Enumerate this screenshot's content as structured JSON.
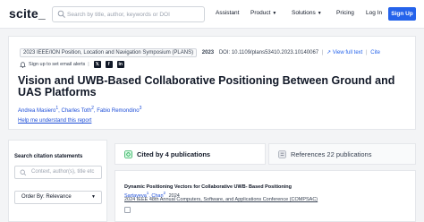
{
  "header": {
    "logo": "scite_",
    "search_placeholder": "Search by title, author, keywords or DOI",
    "nav": [
      {
        "label": "Assistant",
        "dropdown": false
      },
      {
        "label": "Product",
        "dropdown": true
      },
      {
        "label": "Solutions",
        "dropdown": true
      },
      {
        "label": "Pricing",
        "dropdown": false
      },
      {
        "label": "Log In",
        "dropdown": false
      }
    ],
    "signup_label": "Sign Up",
    "accent_color": "#2563eb"
  },
  "paper": {
    "venue": "2023 IEEE/ION Position, Location and Navigation Symposium (PLANS)",
    "year": "2023",
    "doi": "DOI: 10.1109/plans53410.2023.10140067",
    "view_full_text": "View full text",
    "cite": "Cite",
    "alert_label": "Sign up to set email alerts",
    "social_icons": [
      "twitter-icon",
      "facebook-icon",
      "linkedin-icon"
    ],
    "title": "Vision and UWB-Based Collaborative Positioning Between Ground and UAS Platforms",
    "authors": [
      {
        "name": "Andrea Masiero",
        "sup": "1"
      },
      {
        "name": "Charles Toth",
        "sup": "2"
      },
      {
        "name": "Fabio Remondino",
        "sup": "3"
      }
    ],
    "help_link": "Help me understand this report"
  },
  "sidebar": {
    "heading": "Search citation statements",
    "context_placeholder": "Context, author(s), title etc",
    "order_label": "Order By: Relevance"
  },
  "tabs": [
    {
      "label": "Cited by 4 publications",
      "active": true
    },
    {
      "label": "References 22 publications",
      "active": false
    }
  ],
  "results": [
    {
      "title": "Dynamic Positioning Vectors for Collaborative UWB- Based Positioning",
      "authors": [
        {
          "name": "Sartayeva",
          "sup": "1"
        },
        {
          "name": "Chan",
          "sup": "2"
        }
      ],
      "year": "2024",
      "venue": "2024 IEEE 48th Annual Computers, Software, and Applications Conference (COMPSAC)"
    }
  ]
}
